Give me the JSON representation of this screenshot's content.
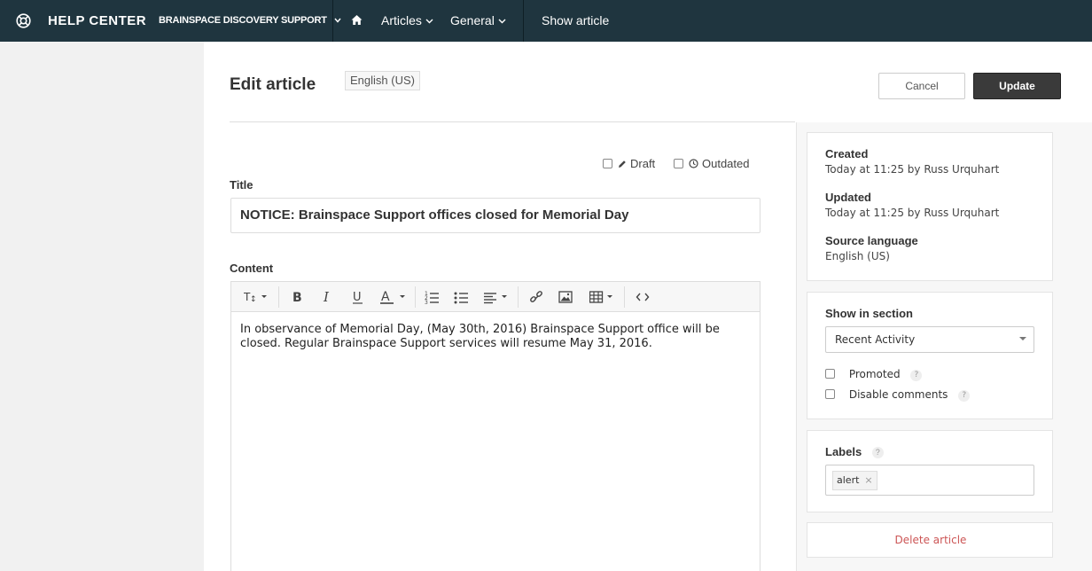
{
  "topbar": {
    "brand": "HELP CENTER",
    "product": "BRAINSPACE DISCOVERY SUPPORT",
    "nav": [
      {
        "label": "Articles"
      },
      {
        "label": "General"
      },
      {
        "label": "Show article"
      }
    ]
  },
  "page": {
    "title": "Edit article",
    "language": "English (US)",
    "cancel_label": "Cancel",
    "update_label": "Update"
  },
  "status": {
    "draft_label": "Draft",
    "outdated_label": "Outdated"
  },
  "form": {
    "title_label": "Title",
    "title_value": "NOTICE: Brainspace Support offices closed for Memorial Day",
    "content_label": "Content",
    "content_text": "In observance of Memorial Day, (May 30th, 2016) Brainspace Support office will be closed. Regular Brainspace Support services will resume May 31, 2016."
  },
  "editor_toolbar": {
    "icons": [
      "text-size-icon",
      "bold-icon",
      "italic-icon",
      "underline-icon",
      "text-color-icon",
      "ordered-list-icon",
      "bullet-list-icon",
      "align-icon",
      "link-icon",
      "image-icon",
      "table-icon",
      "code-icon"
    ]
  },
  "sidebar": {
    "created_label": "Created",
    "created_value": "Today at 11:25 by Russ Urquhart",
    "updated_label": "Updated",
    "updated_value": "Today at 11:25 by Russ Urquhart",
    "source_language_label": "Source language",
    "source_language_value": "English (US)",
    "show_in_section_label": "Show in section",
    "section_value": "Recent Activity",
    "promoted_label": "Promoted",
    "disable_comments_label": "Disable comments",
    "help_glyph": "?",
    "labels_label": "Labels",
    "labels": [
      {
        "text": "alert",
        "remove": "×"
      }
    ],
    "delete_label": "Delete article"
  },
  "colors": {
    "topbar_bg": "#1f353f",
    "update_bg": "#3a3a3a",
    "delete_text": "#c55555"
  }
}
